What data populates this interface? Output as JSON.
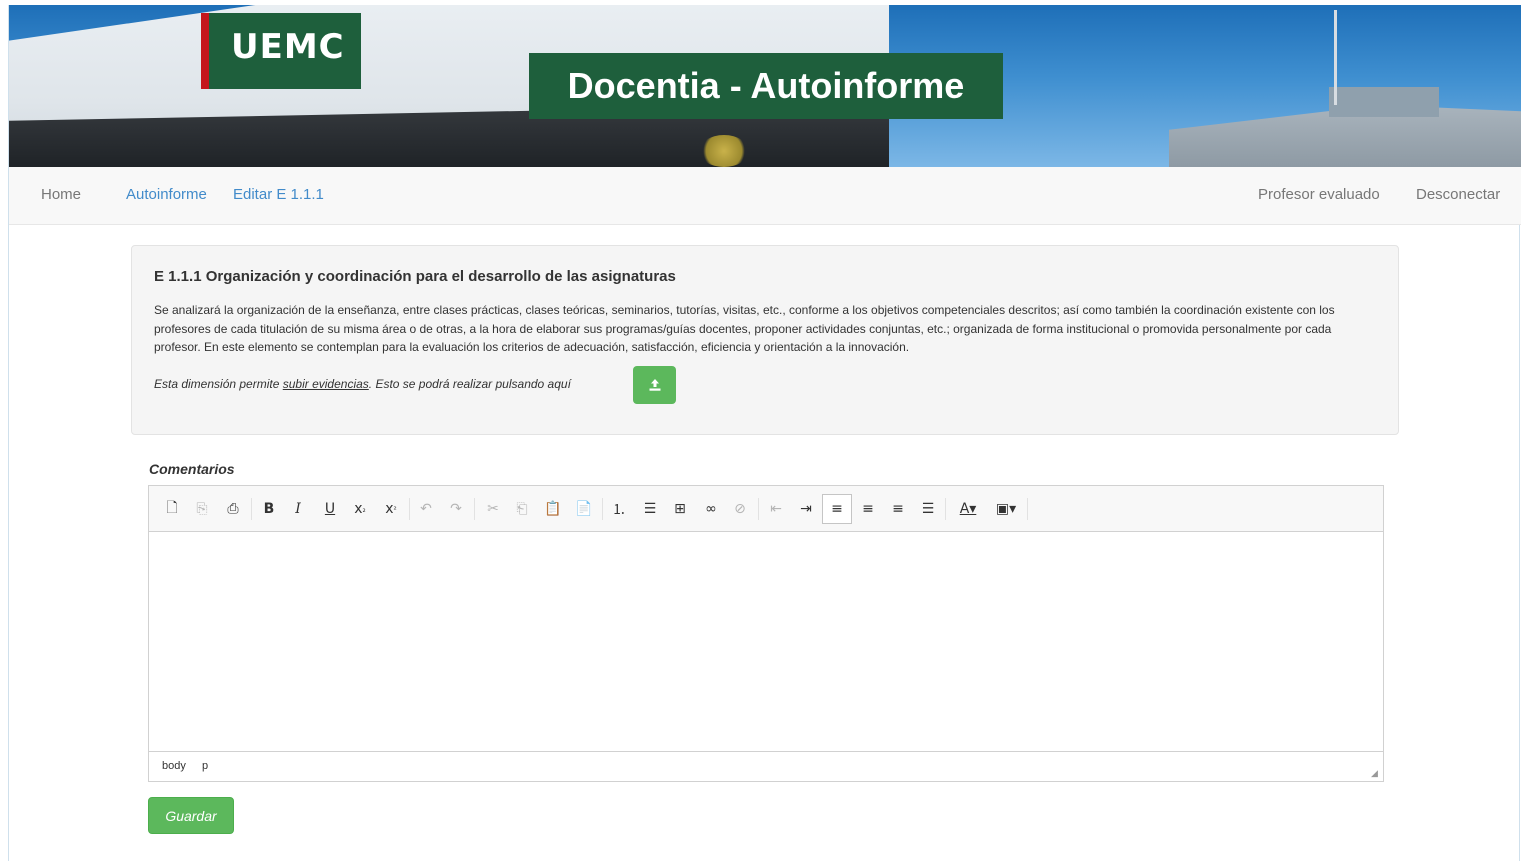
{
  "banner": {
    "logo_text": "UEMC",
    "title": "Docentia - Autoinforme",
    "brand_color": "#1e5f3c"
  },
  "navbar": {
    "home": "Home",
    "autoinforme": "Autoinforme",
    "editar": "Editar E 1.1.1",
    "profesor": "Profesor evaluado",
    "desconectar": "Desconectar"
  },
  "panel": {
    "heading": "E 1.1.1 Organización y coordinación para el desarrollo de las asignaturas",
    "description": "Se analizará la organización de la enseñanza, entre clases prácticas, clases teóricas, seminarios, tutorías, visitas, etc., conforme a los objetivos competenciales descritos; así como también la coordinación existente con los profesores de cada titulación de su misma área o de otras, a la hora de elaborar sus programas/guías docentes, proponer actividades conjuntas, etc.; organizada de forma institucional o promovida personalmente por cada profesor. En este elemento se contemplan para la evaluación los criterios de adecuación, satisfacción, eficiencia y orientación a la innovación.",
    "note_prefix": "Esta dimensión permite ",
    "note_link": "subir evidencias",
    "note_suffix": ". Esto se podrá realizar pulsando aquí",
    "upload_icon": "upload-icon"
  },
  "editor": {
    "label": "Comentarios",
    "status_path": [
      "body",
      "p"
    ],
    "content": ""
  },
  "actions": {
    "save_label": "Guardar",
    "accent": "#5cb85c"
  }
}
